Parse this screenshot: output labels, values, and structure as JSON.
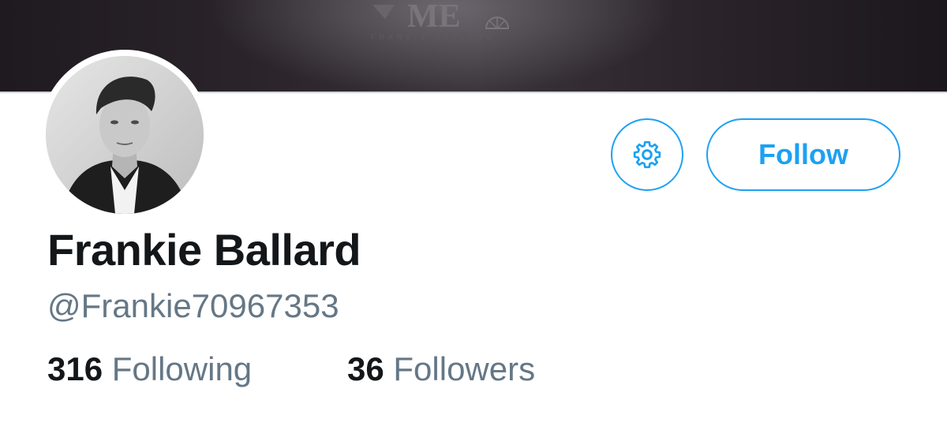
{
  "banner": {
    "logo_text": "ME",
    "logo_subtext": "FRANKIE BALLARD"
  },
  "profile": {
    "display_name": "Frankie Ballard",
    "handle": "@Frankie70967353"
  },
  "actions": {
    "settings_icon": "gear-icon",
    "follow_label": "Follow"
  },
  "stats": {
    "following_count": "316",
    "following_label": "Following",
    "followers_count": "36",
    "followers_label": "Followers"
  },
  "colors": {
    "accent": "#1da1f2",
    "primary_text": "#14171a",
    "secondary_text": "#657786"
  }
}
